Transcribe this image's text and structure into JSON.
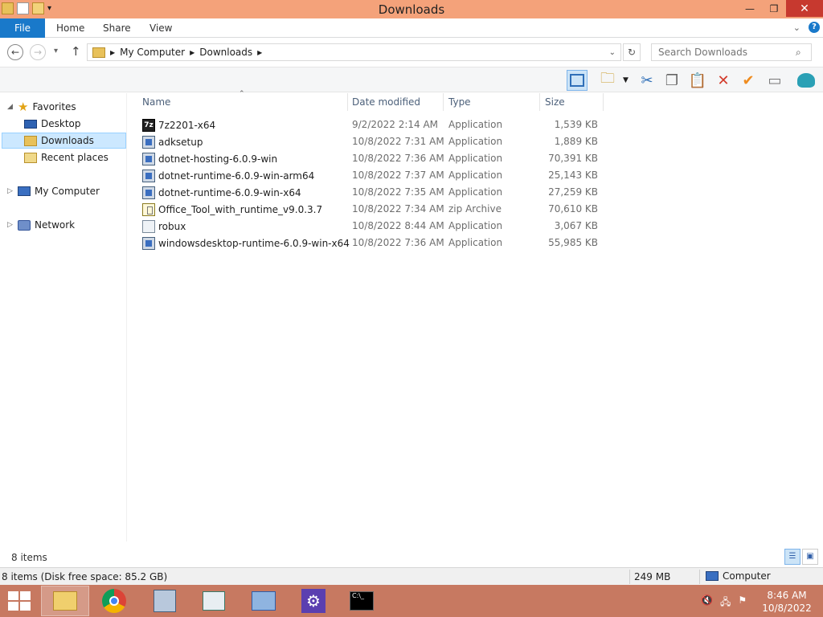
{
  "window": {
    "title": "Downloads"
  },
  "titlebar_buttons": {
    "minimize": "—",
    "maximize": "❐",
    "close": "✕"
  },
  "ribbon": {
    "file": "File",
    "tabs": [
      "Home",
      "Share",
      "View"
    ],
    "help": "?"
  },
  "address": {
    "segments": [
      "My Computer",
      "Downloads"
    ],
    "search_placeholder": "Search Downloads"
  },
  "nav_pane": {
    "favorites": "Favorites",
    "items": [
      "Desktop",
      "Downloads",
      "Recent places"
    ],
    "my_computer": "My Computer",
    "network": "Network"
  },
  "columns": {
    "name": "Name",
    "date": "Date modified",
    "type": "Type",
    "size": "Size"
  },
  "files": [
    {
      "name": "7z2201-x64",
      "date": "9/2/2022 2:14 AM",
      "type": "Application",
      "size": "1,539 KB",
      "icon": "7zip-icon"
    },
    {
      "name": "adksetup",
      "date": "10/8/2022 7:31 AM",
      "type": "Application",
      "size": "1,889 KB",
      "icon": "installer-icon"
    },
    {
      "name": "dotnet-hosting-6.0.9-win",
      "date": "10/8/2022 7:36 AM",
      "type": "Application",
      "size": "70,391 KB",
      "icon": "installer-icon"
    },
    {
      "name": "dotnet-runtime-6.0.9-win-arm64",
      "date": "10/8/2022 7:37 AM",
      "type": "Application",
      "size": "25,143 KB",
      "icon": "installer-icon"
    },
    {
      "name": "dotnet-runtime-6.0.9-win-x64",
      "date": "10/8/2022 7:35 AM",
      "type": "Application",
      "size": "27,259 KB",
      "icon": "installer-icon"
    },
    {
      "name": "Office_Tool_with_runtime_v9.0.3.7",
      "date": "10/8/2022 7:34 AM",
      "type": "zip Archive",
      "size": "70,610 KB",
      "icon": "zip-icon"
    },
    {
      "name": "robux",
      "date": "10/8/2022 8:44 AM",
      "type": "Application",
      "size": "3,067 KB",
      "icon": "application-icon"
    },
    {
      "name": "windowsdesktop-runtime-6.0.9-win-x64",
      "date": "10/8/2022 7:36 AM",
      "type": "Application",
      "size": "55,985 KB",
      "icon": "installer-icon"
    }
  ],
  "status": {
    "item_count": "8 items",
    "bar_left": "8 items (Disk free space: 85.2 GB)",
    "bar_size": "249 MB",
    "bar_location": "Computer"
  },
  "taskbar": {
    "clock_time": "8:46 AM",
    "clock_date": "10/8/2022",
    "apps": [
      "file-explorer-icon",
      "chrome-icon",
      "network-installer-icon",
      "document-viewer-icon",
      "remote-desktop-icon",
      "settings-icon",
      "command-prompt-icon"
    ]
  },
  "colors": {
    "titlebar": "#f4a27a",
    "file_tab": "#1979ca",
    "taskbar": "#c77961",
    "selection": "#cce8ff"
  }
}
